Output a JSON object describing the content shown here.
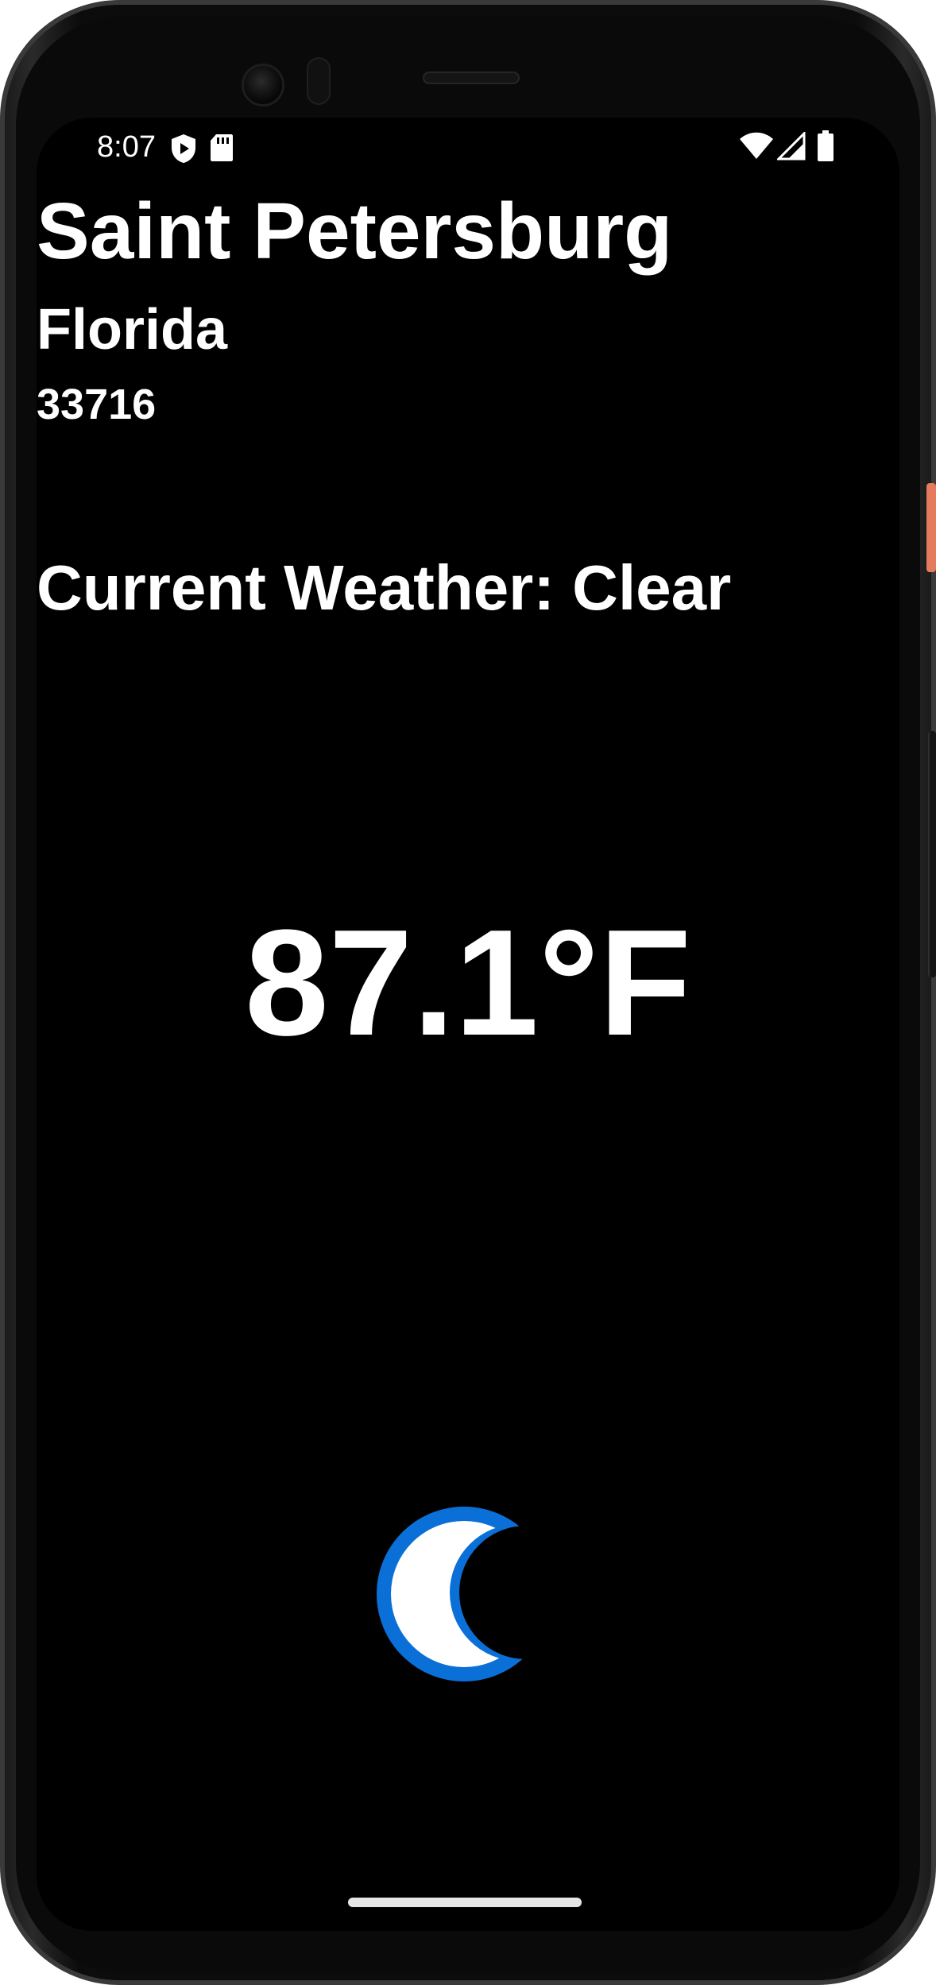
{
  "status_bar": {
    "time": "8:07",
    "left_icons": [
      "shield-play-icon",
      "sd-card-icon"
    ],
    "right_icons": [
      "wifi-icon",
      "cellular-signal-icon",
      "battery-icon"
    ]
  },
  "location": {
    "city": "Saint Petersburg",
    "state": "Florida",
    "zip": "33716"
  },
  "weather": {
    "current_line": "Current Weather: Clear",
    "temperature": "87.1°F",
    "icon": "crescent-moon-icon",
    "icon_color": "#0a6fd6"
  },
  "colors": {
    "background": "#000000",
    "text": "#ffffff",
    "accent_side_button": "#e57a5c"
  }
}
